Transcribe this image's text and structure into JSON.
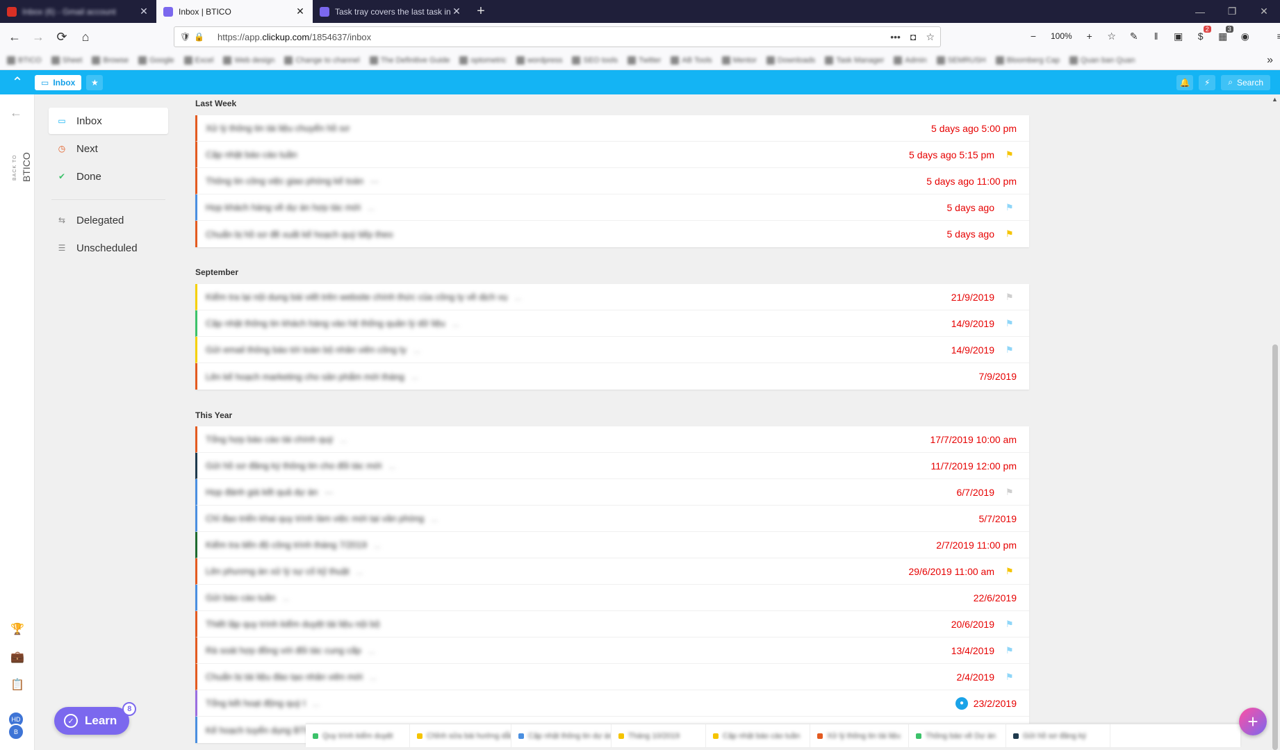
{
  "browser": {
    "tabs": [
      {
        "title": "Inbox (6) - Gmail account",
        "fav_color": "#d93025",
        "blur": true
      },
      {
        "title": "Inbox | BTICO",
        "fav_color": "#7b68ee",
        "blur": false
      },
      {
        "title": "Task tray covers the last task in",
        "fav_color": "#7b68ee",
        "blur": false
      }
    ],
    "url_prefix": "https://app.",
    "url_domain": "clickup.com",
    "url_path": "/1854637/inbox",
    "zoom": "100%",
    "ext_badge_1": "2",
    "ext_badge_2": "3",
    "bookmarks": [
      "BTICO",
      "Sheet",
      "Browse",
      "Google",
      "Excel",
      "Web design",
      "Change to channel",
      "The Definitive Guide",
      "optometric",
      "wordpress",
      "SEO tools",
      "Twitter",
      "AB Tools",
      "Mentor",
      "Downloads",
      "Task Manager",
      "Admin",
      "SEMRUSH",
      "Bloomberg Cap",
      "Quan ban Quan"
    ]
  },
  "app": {
    "inbox_label": "Inbox",
    "search_label": "Search",
    "back_small": "BACK TO",
    "back_big": "BTICO",
    "avatar_1": "HD",
    "avatar_2": "B"
  },
  "sidenav": {
    "primary": [
      {
        "label": "Inbox",
        "icon": "inbox-icon",
        "color": "#14b4f4"
      },
      {
        "label": "Next",
        "icon": "clock-icon",
        "color": "#e35b21"
      },
      {
        "label": "Done",
        "icon": "check-icon",
        "color": "#3cc26a"
      }
    ],
    "secondary": [
      {
        "label": "Delegated",
        "icon": "delegate-icon"
      },
      {
        "label": "Unscheduled",
        "icon": "list-icon"
      }
    ]
  },
  "groups": [
    {
      "title": "Last Week",
      "tasks": [
        {
          "name": "Xử lý thông tin tài liệu chuyển hồ sơ",
          "extra": "",
          "due": "5 days ago 5:00 pm",
          "flag": "",
          "color": "#e35b21"
        },
        {
          "name": "Cập nhật báo cáo tuần",
          "extra": "",
          "due": "5 days ago 5:15 pm",
          "flag": "yellow",
          "color": "#e35b21"
        },
        {
          "name": "Thông tin công việc giao phòng kế toán",
          "extra": "---",
          "due": "5 days ago 11:00 pm",
          "flag": "",
          "color": "#e35b21"
        },
        {
          "name": "Họp khách hàng về dự án hợp tác mới",
          "extra": "...",
          "due": "5 days ago",
          "flag": "blue",
          "color": "#4a8fe0"
        },
        {
          "name": "Chuẩn bị hồ sơ đề xuất kế hoạch quý tiếp theo",
          "extra": "",
          "due": "5 days ago",
          "flag": "yellow",
          "color": "#e35b21"
        }
      ]
    },
    {
      "title": "September",
      "tasks": [
        {
          "name": "Kiểm tra lại nội dung bài viết trên website chính thức của công ty về dịch vụ",
          "extra": "...",
          "due": "21/9/2019",
          "flag": "gray",
          "color": "#f5d000"
        },
        {
          "name": "Cập nhật thông tin khách hàng vào hệ thống quản lý dữ liệu",
          "extra": "...",
          "due": "14/9/2019",
          "flag": "blue",
          "color": "#3cc26a"
        },
        {
          "name": "Gửi email thông báo tới toàn bộ nhân viên công ty",
          "extra": "...",
          "due": "14/9/2019",
          "flag": "blue",
          "color": "#f5d000"
        },
        {
          "name": "Lên kế hoạch marketing cho sản phẩm mới tháng",
          "extra": "...",
          "due": "7/9/2019",
          "flag": "",
          "color": "#e35b21"
        }
      ]
    },
    {
      "title": "This Year",
      "tasks": [
        {
          "name": "Tổng hợp báo cáo tài chính quý",
          "extra": "...",
          "due": "17/7/2019 10:00 am",
          "flag": "",
          "color": "#e35b21"
        },
        {
          "name": "Gửi hồ sơ đăng ký thông tin cho đối tác mới",
          "extra": "...",
          "due": "11/7/2019 12:00 pm",
          "flag": "",
          "color": "#1f3a4d"
        },
        {
          "name": "Họp đánh giá kết quả dự án",
          "extra": "---",
          "due": "6/7/2019",
          "flag": "gray",
          "color": "#4a8fe0"
        },
        {
          "name": "Chỉ đạo triển khai quy trình làm việc mới tại văn phòng",
          "extra": "...",
          "due": "5/7/2019",
          "flag": "",
          "color": "#4a8fe0"
        },
        {
          "name": "Kiểm tra tiến độ công trình tháng 7/2019",
          "extra": "...",
          "due": "2/7/2019 11:00 pm",
          "flag": "",
          "color": "#1e6b30"
        },
        {
          "name": "Lên phương án xử lý sự cố kỹ thuật",
          "extra": "...",
          "due": "29/6/2019 11:00 am",
          "flag": "yellow",
          "color": "#e35b21"
        },
        {
          "name": "Gửi báo cáo tuần",
          "extra": "...",
          "due": "22/6/2019",
          "flag": "",
          "color": "#4a8fe0"
        },
        {
          "name": "Thiết lập quy trình kiểm duyệt tài liệu nội bộ",
          "extra": "",
          "due": "20/6/2019",
          "flag": "blue",
          "color": "#e35b21"
        },
        {
          "name": "Rà soát hợp đồng với đối tác cung cấp",
          "extra": "...",
          "due": "13/4/2019",
          "flag": "blue",
          "color": "#e35b21"
        },
        {
          "name": "Chuẩn bị tài liệu đào tạo nhân viên mới",
          "extra": "...",
          "due": "2/4/2019",
          "flag": "blue",
          "color": "#e35b21"
        },
        {
          "name": "Tổng kết hoạt động quý I",
          "extra": "...",
          "due": "23/2/2019",
          "flag": "",
          "assignee": true,
          "color": "#9a6ee0"
        },
        {
          "name": "Kế hoạch tuyển dụng BTICO",
          "extra": "",
          "due": "",
          "flag": "",
          "color": "#4a8fe0"
        }
      ]
    }
  ],
  "tray": [
    {
      "label": "Quy trình kiểm duyệt",
      "color": "#3cc26a"
    },
    {
      "label": "Chỉnh sửa bài hướng dẫn",
      "color": "#f5c400"
    },
    {
      "label": "Cập nhật thông tin dự án",
      "color": "#4a8fe0"
    },
    {
      "label": "Tháng 10/2019",
      "color": "#f5c400"
    },
    {
      "label": "Cập nhật báo cáo tuần",
      "color": "#f5c400"
    },
    {
      "label": "Xử lý thông tin tài liệu",
      "color": "#e35b21"
    },
    {
      "label": "Thông báo về Dự án",
      "color": "#3cc26a"
    },
    {
      "label": "Gửi hồ sơ đăng ký",
      "color": "#1f3a4d"
    }
  ],
  "learn": {
    "label": "Learn",
    "count": "8"
  }
}
